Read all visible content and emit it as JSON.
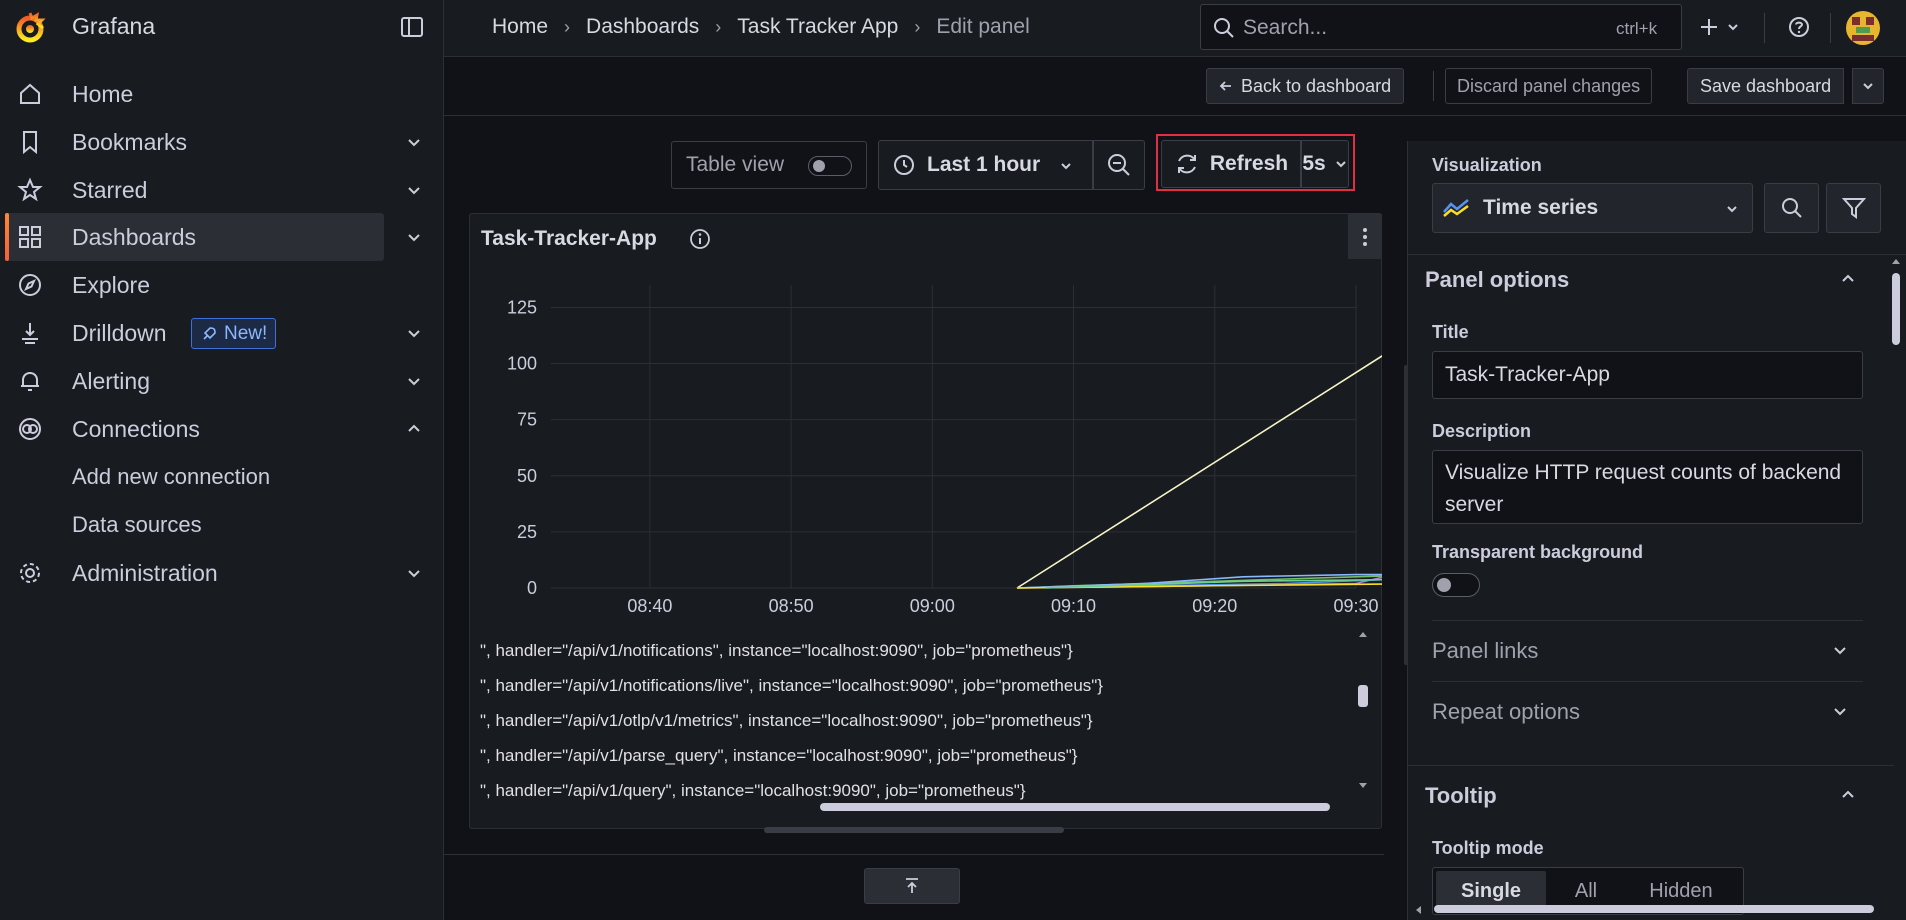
{
  "app": {
    "name": "Grafana"
  },
  "nav": {
    "items": [
      {
        "label": "Home"
      },
      {
        "label": "Bookmarks"
      },
      {
        "label": "Starred"
      },
      {
        "label": "Dashboards"
      },
      {
        "label": "Explore"
      },
      {
        "label": "Drilldown",
        "badge": "New!"
      },
      {
        "label": "Alerting"
      },
      {
        "label": "Connections"
      },
      {
        "label": "Administration"
      }
    ],
    "sub_items": [
      {
        "label": "Add new connection"
      },
      {
        "label": "Data sources"
      }
    ]
  },
  "breadcrumb": [
    "Home",
    "Dashboards",
    "Task Tracker App",
    "Edit panel"
  ],
  "search": {
    "placeholder": "Search...",
    "shortcut": "ctrl+k"
  },
  "toolbar": {
    "back": "Back to dashboard",
    "discard": "Discard panel changes",
    "save": "Save dashboard"
  },
  "panel_toolbar": {
    "table_view": "Table view",
    "time_range": "Last 1 hour",
    "refresh": "Refresh",
    "refresh_interval": "5s"
  },
  "panel": {
    "title": "Task-Tracker-App"
  },
  "chart_data": {
    "type": "line",
    "title": "Task-Tracker-App",
    "x_ticks": [
      "08:40",
      "08:50",
      "09:00",
      "09:10",
      "09:20",
      "09:30"
    ],
    "y_ticks": [
      "0",
      "25",
      "50",
      "75",
      "100",
      "125"
    ],
    "ylim": [
      0,
      135
    ],
    "xlim_minutes": [
      0,
      57
    ],
    "series": [
      {
        "color": "#f5f5c8",
        "x": [
          "09:06",
          "09:36"
        ],
        "y": [
          0,
          120
        ]
      },
      {
        "color": "#73bf69",
        "x": [
          "09:06",
          "09:10",
          "09:20",
          "09:30",
          "09:36"
        ],
        "y": [
          0,
          1,
          3,
          5,
          6
        ]
      },
      {
        "color": "#8ab8ff",
        "x": [
          "09:06",
          "09:15",
          "09:22",
          "09:30",
          "09:36"
        ],
        "y": [
          0,
          2,
          5,
          6,
          6
        ]
      },
      {
        "color": "#b877d9",
        "x": [
          "09:06",
          "09:20",
          "09:30",
          "09:34",
          "09:36"
        ],
        "y": [
          0,
          1,
          2,
          8,
          22
        ]
      },
      {
        "color": "#5794f2",
        "x": [
          "09:06",
          "09:25",
          "09:33",
          "09:36"
        ],
        "y": [
          0,
          2,
          4,
          20
        ]
      },
      {
        "color": "#fade2a",
        "x": [
          "09:06",
          "09:20",
          "09:36"
        ],
        "y": [
          0,
          1,
          2
        ]
      },
      {
        "color": "#6ccf8e",
        "x": [
          "09:08",
          "09:22",
          "09:36"
        ],
        "y": [
          0,
          3,
          4
        ]
      }
    ],
    "legend": [
      "\", handler=\"/api/v1/notifications\", instance=\"localhost:9090\", job=\"prometheus\"}",
      "\", handler=\"/api/v1/notifications/live\", instance=\"localhost:9090\", job=\"prometheus\"}",
      "\", handler=\"/api/v1/otlp/v1/metrics\", instance=\"localhost:9090\", job=\"prometheus\"}",
      "\", handler=\"/api/v1/parse_query\", instance=\"localhost:9090\", job=\"prometheus\"}",
      "\", handler=\"/api/v1/query\", instance=\"localhost:9090\", job=\"prometheus\"}"
    ]
  },
  "options": {
    "visualization_label": "Visualization",
    "visualization": "Time series",
    "panel_options": "Panel options",
    "title_label": "Title",
    "title_value": "Task-Tracker-App",
    "description_label": "Description",
    "description_value": "Visualize HTTP request counts of backend server",
    "transparent_label": "Transparent background",
    "panel_links": "Panel links",
    "repeat_options": "Repeat options",
    "tooltip": "Tooltip",
    "tooltip_mode_label": "Tooltip mode",
    "tooltip_modes": [
      "Single",
      "All",
      "Hidden"
    ]
  },
  "colors": {
    "accent": "#f55f3e",
    "highlight": "#e02f44"
  }
}
